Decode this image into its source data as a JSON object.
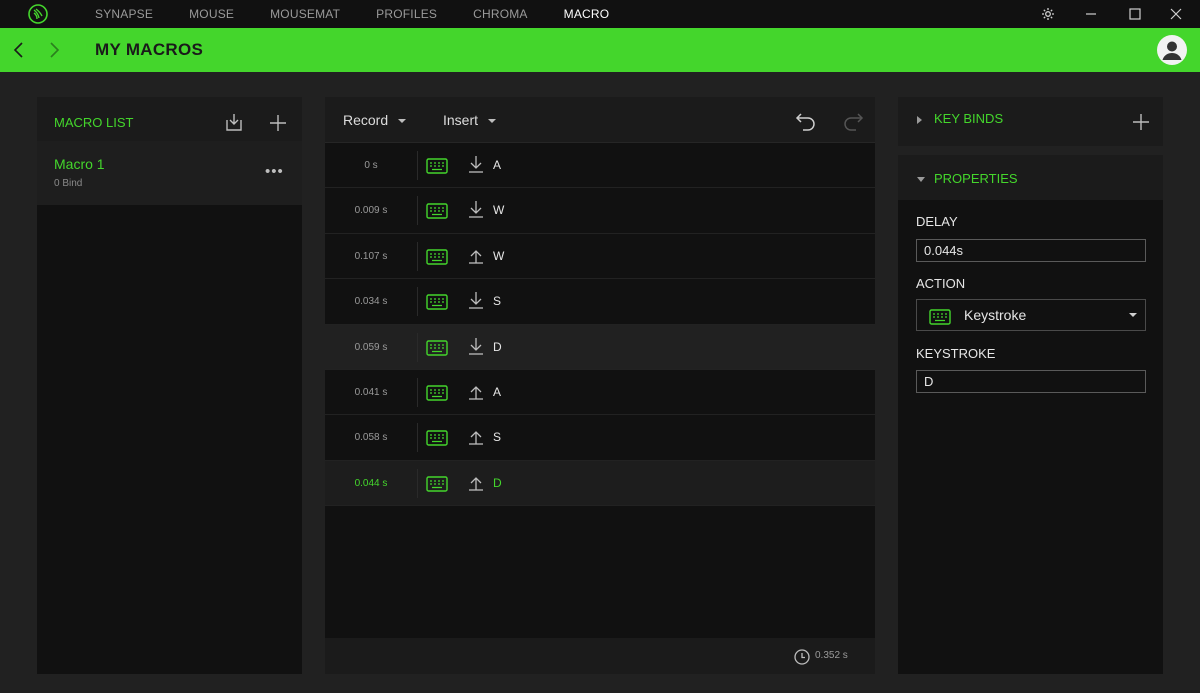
{
  "nav": {
    "items": [
      "SYNAPSE",
      "MOUSE",
      "MOUSEMAT",
      "PROFILES",
      "CHROMA",
      "MACRO"
    ],
    "active": "MACRO"
  },
  "header": {
    "title": "MY MACROS"
  },
  "colors": {
    "accent": "#44d62c",
    "background": "#212121",
    "panel": "#111111"
  },
  "macro_list": {
    "label": "MACRO LIST",
    "items": [
      {
        "name": "Macro 1",
        "binds": "0 Bind"
      }
    ]
  },
  "editor": {
    "record_label": "Record",
    "insert_label": "Insert",
    "rows": [
      {
        "time": "0 s",
        "direction": "down",
        "key": "A"
      },
      {
        "time": "0.009 s",
        "direction": "down",
        "key": "W"
      },
      {
        "time": "0.107 s",
        "direction": "up",
        "key": "W"
      },
      {
        "time": "0.034 s",
        "direction": "down",
        "key": "S"
      },
      {
        "time": "0.059 s",
        "direction": "down",
        "key": "D"
      },
      {
        "time": "0.041 s",
        "direction": "up",
        "key": "A"
      },
      {
        "time": "0.058 s",
        "direction": "up",
        "key": "S"
      },
      {
        "time": "0.044 s",
        "direction": "up",
        "key": "D"
      }
    ],
    "hovered_row": 4,
    "selected_row": 7,
    "total_time": "0.352 s"
  },
  "key_binds": {
    "label": "KEY BINDS"
  },
  "properties": {
    "label": "PROPERTIES",
    "delay_label": "DELAY",
    "delay_value": "0.044s",
    "action_label": "ACTION",
    "action_value": "Keystroke",
    "keystroke_label": "KEYSTROKE",
    "keystroke_value": "D"
  }
}
